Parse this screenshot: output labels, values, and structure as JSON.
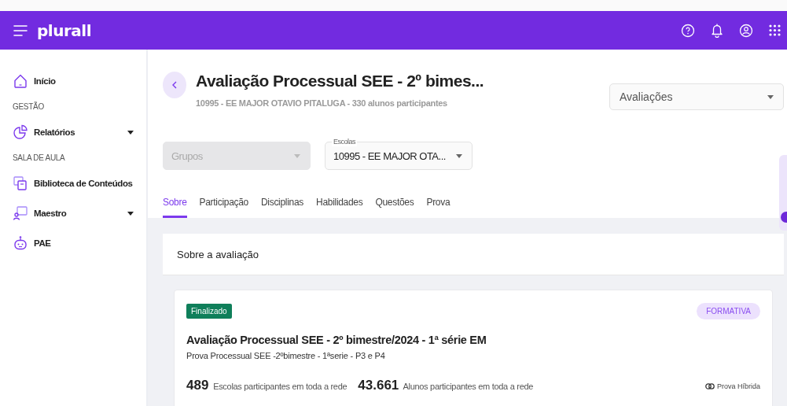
{
  "header": {
    "logo": "plurall"
  },
  "sidebar": {
    "entries": [
      {
        "kind": "link",
        "label": "Início",
        "expandable": false
      },
      {
        "kind": "heading",
        "label": "GESTÃO"
      },
      {
        "kind": "link",
        "label": "Relatórios",
        "expandable": true
      },
      {
        "kind": "heading",
        "label": "SALA DE AULA"
      },
      {
        "kind": "link",
        "label": "Biblioteca de Conteúdos",
        "expandable": false
      },
      {
        "kind": "link",
        "label": "Maestro",
        "expandable": true
      },
      {
        "kind": "link",
        "label": "PAE",
        "expandable": false
      }
    ]
  },
  "page": {
    "title": "Avaliação Processual SEE - 2º bimes...",
    "subtitle": "10995 - EE MAJOR OTAVIO PITALUGA - 330 alunos participantes",
    "view_select": {
      "value": "Avaliações"
    }
  },
  "filters": [
    {
      "placeholder": "Grupos",
      "disabled": true
    },
    {
      "label": "Escolas",
      "value": "10995 - EE MAJOR OTA...",
      "disabled": false
    }
  ],
  "tabs": [
    {
      "label": "Sobre",
      "selected": true
    },
    {
      "label": "Participação",
      "selected": false
    },
    {
      "label": "Disciplinas",
      "selected": false
    },
    {
      "label": "Habilidades",
      "selected": false
    },
    {
      "label": "Questões",
      "selected": false
    },
    {
      "label": "Prova",
      "selected": false
    }
  ],
  "section": {
    "title": "Sobre a avaliação"
  },
  "card": {
    "status": "Finalizado",
    "type": "FORMATIVA",
    "title": "Avaliação Processual SEE - 2º bimestre/2024 - 1ª série EM",
    "description": "Prova Processual SEE -2ºbimestre - 1ªserie - P3 e P4",
    "stats": [
      "**489** Escolas participantes em toda a rede",
      "**43.661** Alunos participantes em toda a rede"
    ],
    "mode": "Prova Híbrida"
  }
}
